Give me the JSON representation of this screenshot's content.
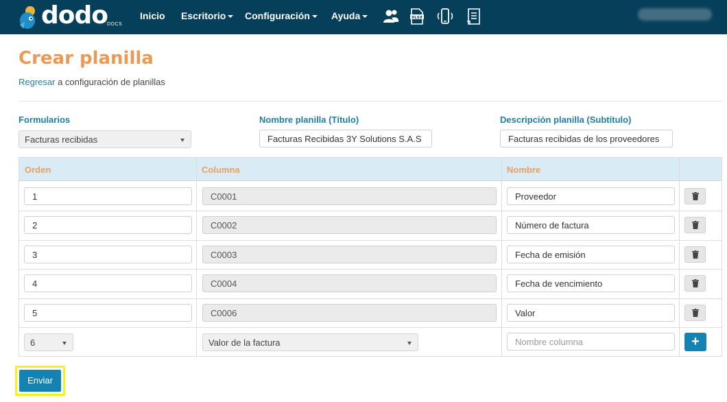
{
  "app": {
    "logo_text": "dodo",
    "logo_sub": "DOCS",
    "accent_color": "#ea9a55",
    "nav_bg": "#063f5a",
    "primary_button_color": "#1383b3"
  },
  "nav": {
    "items": [
      {
        "label": "Inicio",
        "dropdown": false
      },
      {
        "label": "Escritorio",
        "dropdown": true
      },
      {
        "label": "Configuración",
        "dropdown": true
      },
      {
        "label": "Ayuda",
        "dropdown": true
      }
    ],
    "icons": [
      "users-icon",
      "xlsx-file-icon",
      "mobile-vibrate-icon",
      "document-list-icon"
    ]
  },
  "page": {
    "title": "Crear planilla",
    "breadcrumb_link": "Regresar",
    "breadcrumb_text": " a configuración de planillas"
  },
  "form": {
    "formularios_label": "Formularios",
    "formularios_value": "Facturas recibidas",
    "nombre_label": "Nombre planilla (Título)",
    "nombre_value": "Facturas Recibidas 3Y Solutions S.A.S",
    "descripcion_label": "Descripción planilla (Subtítulo)",
    "descripcion_value": "Facturas recibidas de los proveedores"
  },
  "table": {
    "headers": [
      "Orden",
      "Columna",
      "Nombre",
      ""
    ],
    "rows": [
      {
        "orden": "1",
        "columna": "C0001",
        "nombre": "Proveedor"
      },
      {
        "orden": "2",
        "columna": "C0002",
        "nombre": "Número de factura"
      },
      {
        "orden": "3",
        "columna": "C0003",
        "nombre": "Fecha de emisión"
      },
      {
        "orden": "4",
        "columna": "C0004",
        "nombre": "Fecha de vencimiento"
      },
      {
        "orden": "5",
        "columna": "C0006",
        "nombre": "Valor"
      }
    ],
    "new_row": {
      "orden_selected": "6",
      "columna_selected": "Valor de la factura",
      "nombre_placeholder": "Nombre columna",
      "add_label": "+"
    }
  },
  "submit": {
    "label": "Enviar"
  }
}
